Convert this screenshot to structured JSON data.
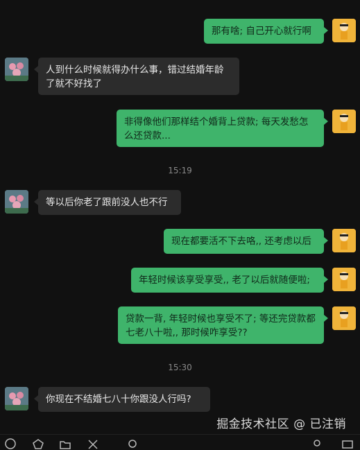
{
  "messages": [
    {
      "sender": "me",
      "text": "那有啥; 自己开心就行啊"
    },
    {
      "sender": "them",
      "text": "人到什么时候就得办什么事，错过结婚年龄了就不好找了"
    },
    {
      "sender": "me",
      "text": "非得像他们那样结个婚背上贷款; 每天发愁怎么还贷款..."
    },
    {
      "sender": "time",
      "text": "15:19"
    },
    {
      "sender": "them",
      "text": "等以后你老了跟前没人也不行"
    },
    {
      "sender": "me",
      "text": "现在都要活不下去咯,, 还考虑以后"
    },
    {
      "sender": "me",
      "text": "年轻时候该享受享受,, 老了以后就随便啦;"
    },
    {
      "sender": "me",
      "text": "贷款一背, 年轻时候也享受不了; 等还完贷款都七老八十啦,, 那时候咋享受??"
    },
    {
      "sender": "time",
      "text": "15:30"
    },
    {
      "sender": "them",
      "text": "你现在不结婚七八十你跟没人行吗?"
    }
  ],
  "watermark": "掘金技术社区 @ 已注销",
  "colors": {
    "background": "#111111",
    "my_bubble": "#3fb46b",
    "their_bubble": "#2c2c2c"
  },
  "toolbar_icons": [
    "emoji-icon",
    "favorite-icon",
    "folder-icon",
    "scissors-icon",
    "chat-history-icon",
    "voice-call-icon",
    "video-call-icon"
  ]
}
